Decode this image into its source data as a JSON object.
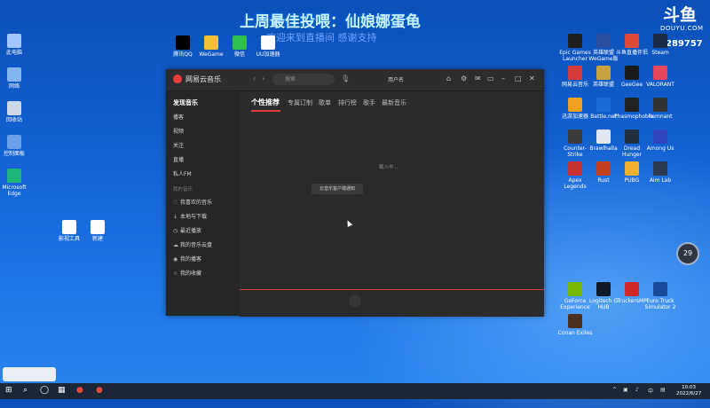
{
  "overlay": {
    "title": "上周最佳投喂：仙娘娜蛋龟",
    "subtitle": "欢迎来到直播间 感谢支持",
    "logo_top": "斗鱼",
    "logo_bottom": "DOUYU.COM",
    "room_number": "289757"
  },
  "desktop_left": [
    {
      "label": "此电脑",
      "color": "#9fc6ff"
    },
    {
      "label": "网络",
      "color": "#7fb4f0"
    },
    {
      "label": "回收站",
      "color": "#cfd8e6"
    },
    {
      "label": "控制面板",
      "color": "#6aa0e8"
    },
    {
      "label": "Microsoft Edge",
      "color": "#1fb57a"
    }
  ],
  "desktop_top": [
    {
      "label": "腾讯QQ",
      "color": "#000000"
    },
    {
      "label": "WeGame",
      "color": "#f2c230"
    },
    {
      "label": "微信",
      "color": "#2fbf4f"
    },
    {
      "label": "UU加速器",
      "color": "#ffffff"
    }
  ],
  "desktop_mid": [
    {
      "label": "影视工具",
      "color": "#ffffff"
    },
    {
      "label": "新建",
      "color": "#ffffff"
    }
  ],
  "desktop_right": [
    {
      "label": "Epic Games Launcher",
      "color": "#1e1e1e"
    },
    {
      "label": "英雄联盟 WeGame版",
      "color": "#2a4ea0"
    },
    {
      "label": "斗鱼直播伴侣",
      "color": "#e04a3a"
    },
    {
      "label": "Steam",
      "color": "#1a2a44"
    },
    {
      "label": "网易云音乐",
      "color": "#d43b3b"
    },
    {
      "label": "英雄联盟",
      "color": "#c8a040"
    },
    {
      "label": "GeeGee",
      "color": "#1a1a1a"
    },
    {
      "label": "VALORANT",
      "color": "#e8465a"
    },
    {
      "label": "迅游加速器",
      "color": "#f0a020"
    },
    {
      "label": "Battle.net",
      "color": "#1a6ad8"
    },
    {
      "label": "Phasmophobia",
      "color": "#222222"
    },
    {
      "label": "Remnant",
      "color": "#333333"
    },
    {
      "label": "Counter-Strike",
      "color": "#3a3a3a"
    },
    {
      "label": "Brawlhalla",
      "color": "#e0e6f0"
    },
    {
      "label": "Dread Hunger",
      "color": "#20303c"
    },
    {
      "label": "Among Us",
      "color": "#3046c0"
    },
    {
      "label": "Apex Legends",
      "color": "#c83232"
    },
    {
      "label": "Rust",
      "color": "#c04020"
    },
    {
      "label": "PUBG",
      "color": "#f0b030"
    },
    {
      "label": "Aim Lab",
      "color": "#2a3a50"
    },
    {
      "label": "GeForce Experience",
      "color": "#76b900"
    },
    {
      "label": "Logitech G HUB",
      "color": "#0e1a28"
    },
    {
      "label": "TruckersMP",
      "color": "#d02828"
    },
    {
      "label": "Euro Truck Simulator 2",
      "color": "#1a4a9a"
    },
    {
      "label": "Conan Exiles",
      "color": "#4a3020"
    }
  ],
  "window": {
    "app_name": "网易云音乐",
    "search_placeholder": "搜索",
    "user_name": "用户名",
    "sidebar": {
      "items": [
        "发现音乐",
        "播客",
        "视频",
        "关注",
        "直播",
        "私人FM"
      ],
      "section_label": "我的音乐",
      "my_items": [
        "我喜欢的音乐",
        "本地与下载",
        "最近播放",
        "我的音乐云盘",
        "我的播客",
        "我的收藏"
      ]
    },
    "tabs": [
      "个性推荐",
      "专属订制",
      "歌单",
      "排行榜",
      "歌手",
      "最新音乐"
    ],
    "loading_text": "载入中...",
    "toast_text": "云音乐客户端通知"
  },
  "bubble_value": "29",
  "taskbar": {
    "time": "10:03",
    "date": "2022/6/27"
  }
}
